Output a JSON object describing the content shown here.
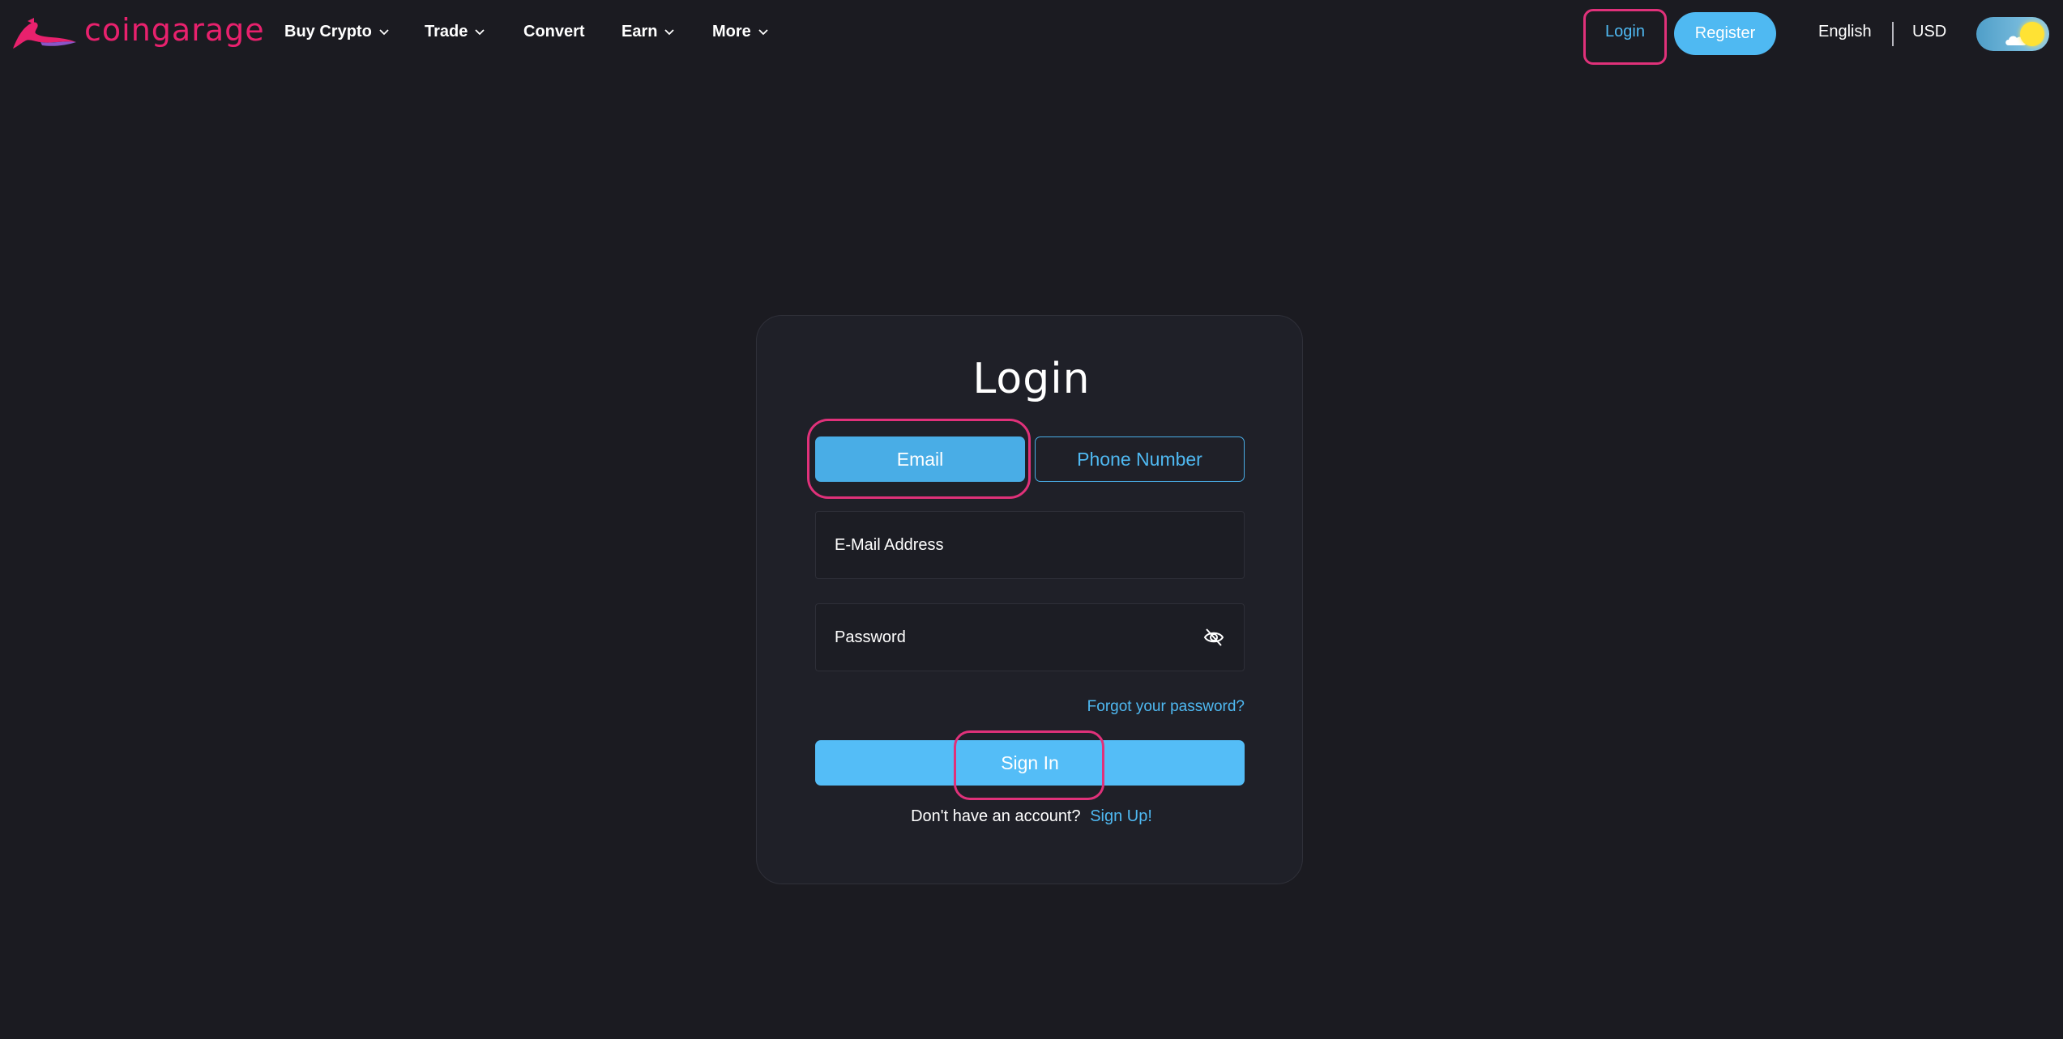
{
  "brand": {
    "name": "coingarage",
    "color": "#e8216d"
  },
  "nav": {
    "items": [
      {
        "label": "Buy Crypto",
        "has_dropdown": true
      },
      {
        "label": "Trade",
        "has_dropdown": true
      },
      {
        "label": "Convert",
        "has_dropdown": false
      },
      {
        "label": "Earn",
        "has_dropdown": true
      },
      {
        "label": "More",
        "has_dropdown": true
      }
    ],
    "login_label": "Login",
    "register_label": "Register",
    "language": "English",
    "currency": "USD",
    "theme_toggle_icon": "sun-icon"
  },
  "login_card": {
    "title": "Login",
    "tabs": [
      {
        "label": "Email",
        "active": true
      },
      {
        "label": "Phone Number",
        "active": false
      }
    ],
    "email_field": {
      "placeholder": "E-Mail Address",
      "value": ""
    },
    "password_field": {
      "placeholder": "Password",
      "value": "",
      "toggle_icon": "eye-slash-icon"
    },
    "forgot_label": "Forgot your password?",
    "signin_label": "Sign In",
    "signup_prompt": "Don't have an account?",
    "signup_link": "Sign Up!"
  },
  "colors": {
    "background": "#1b1b21",
    "card": "#1f2028",
    "accent": "#4fb9f2",
    "highlight": "#e0317a"
  }
}
